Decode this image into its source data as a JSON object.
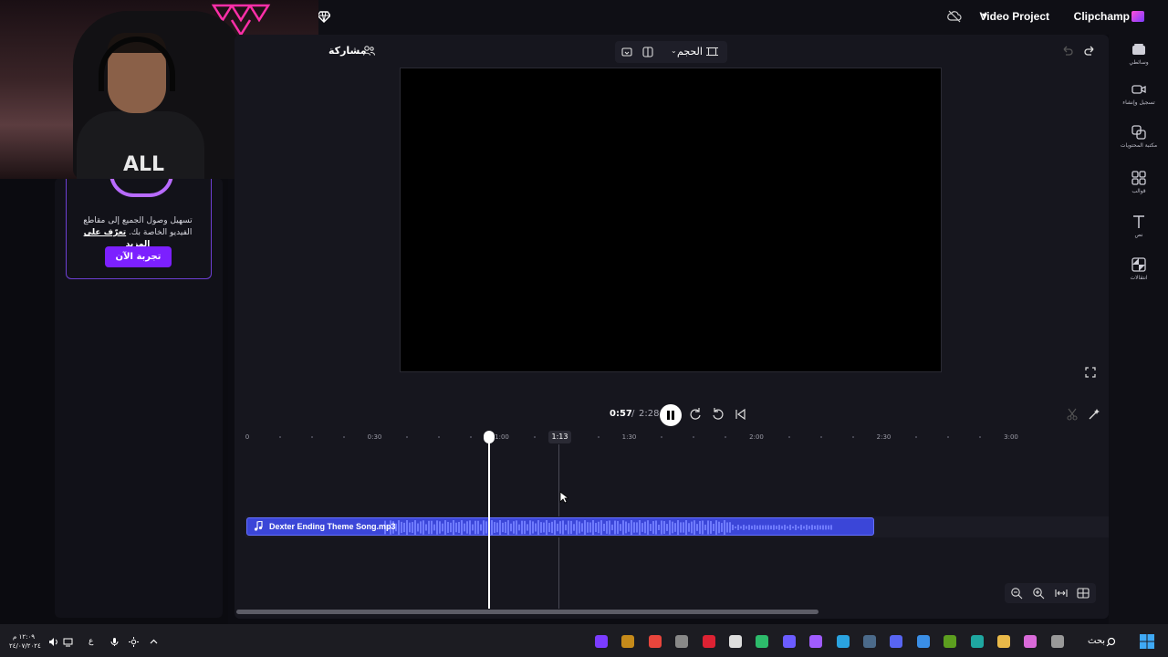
{
  "header": {
    "brand": "Clipchamp",
    "project_name": "Video Project"
  },
  "toolbar": {
    "share_label": "مشاركة",
    "size_label": "الحجم"
  },
  "promo": {
    "text": "تسهيل وصول الجميع إلى مقاطع الفيديو الخاصة بك.",
    "link": "تعرّف على المزيد",
    "button": "تجربة الآن"
  },
  "webcam": {
    "shirt_text": "ALL"
  },
  "right_rail": [
    {
      "label": "وسائطي",
      "icon": "media-icon"
    },
    {
      "label": "تسجيل وإنشاء",
      "icon": "record-icon"
    },
    {
      "label": "مكتبة المحتويات",
      "icon": "content-library-icon"
    },
    {
      "label": "قوالب",
      "icon": "templates-icon"
    },
    {
      "label": "نص",
      "icon": "text-icon"
    },
    {
      "label": "انتقالات",
      "icon": "transitions-icon"
    }
  ],
  "playback": {
    "current": "0:57",
    "separator": "/",
    "total": "2:28"
  },
  "timeline": {
    "ticks": [
      "0",
      "0:30",
      "1:00",
      "1:30",
      "2:00",
      "2:30",
      "3:00"
    ],
    "hover_time": "1:13",
    "playhead_position": "0:57",
    "audio_clip": {
      "name": "Dexter Ending Theme Song.mp3",
      "color": "#3b46d8"
    }
  },
  "taskbar": {
    "search_label": "بحث",
    "language": "ع",
    "time": "١٢:٠٩ م",
    "date": "٢٤/٠٧/٢٠٢٤"
  },
  "colors": {
    "accent": "#7c20ff",
    "editor_bg": "#16161e",
    "audio": "#3b46d8"
  }
}
